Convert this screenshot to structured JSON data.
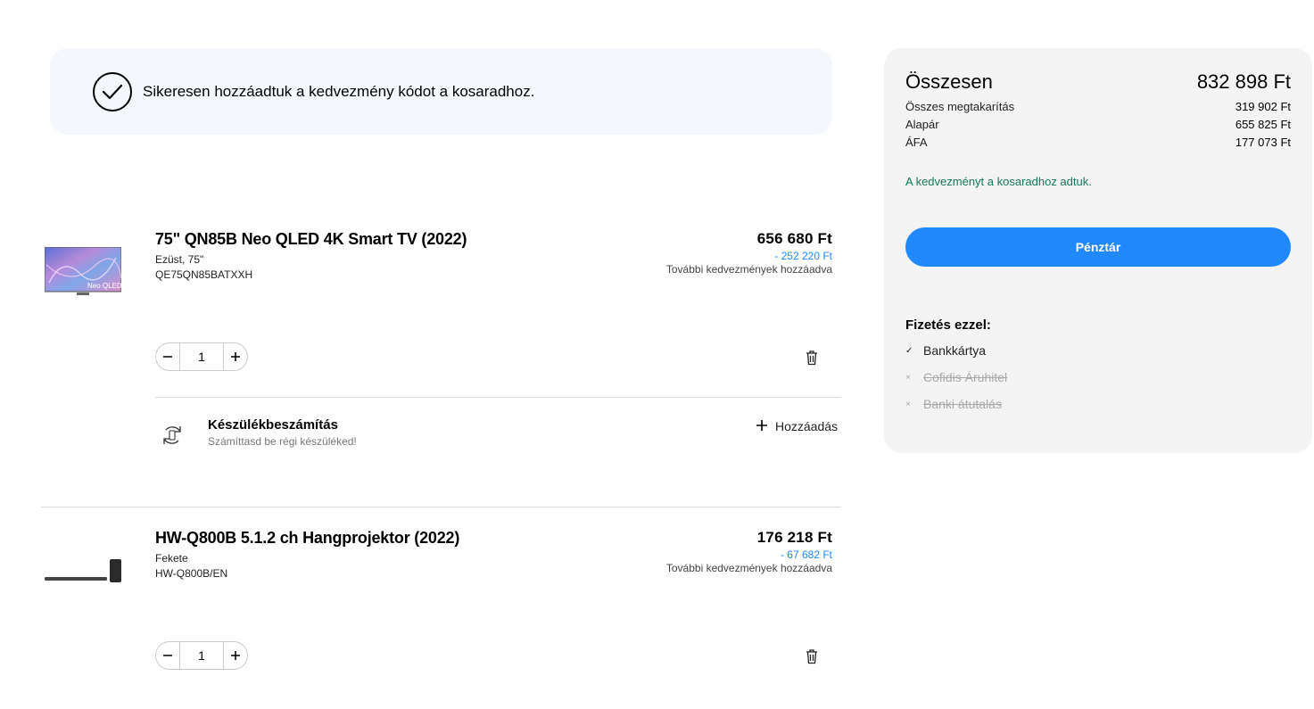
{
  "banner": {
    "message": "Sikeresen hozzáadtuk a kedvezmény kódot a kosaradhoz."
  },
  "cart": {
    "items": [
      {
        "title": "75\" QN85B Neo QLED 4K Smart TV (2022)",
        "variant": "Ezüst, 75\"",
        "sku": "QE75QN85BATXXH",
        "price": "656 680 Ft",
        "discount": "- 252 220 Ft",
        "extra_note": "További kedvezmények hozzáadva",
        "quantity": "1",
        "thumb_label": "Neo QLED"
      },
      {
        "title": "HW-Q800B 5.1.2 ch Hangprojektor (2022)",
        "variant": "Fekete",
        "sku": "HW-Q800B/EN",
        "price": "176 218 Ft",
        "discount": "- 67 682 Ft",
        "extra_note": "További kedvezmények hozzáadva",
        "quantity": "1"
      }
    ],
    "tradein": {
      "title": "Készülékbeszámítás",
      "subtitle": "Számíttasd be régi készüléked!",
      "add_label": "Hozzáadás"
    }
  },
  "summary": {
    "total_label": "Összesen",
    "total_value": "832 898 Ft",
    "rows": [
      {
        "label": "Összes megtakarítás",
        "value": "319 902 Ft"
      },
      {
        "label": "Alapár",
        "value": "655 825 Ft"
      },
      {
        "label": "ÁFA",
        "value": "177 073 Ft"
      }
    ],
    "discount_note": "A kedvezményt a kosaradhoz adtuk.",
    "checkout_label": "Pénztár",
    "payment_title": "Fizetés ezzel:",
    "payment_methods": [
      {
        "label": "Bankkártya",
        "available": true,
        "mark": "✓"
      },
      {
        "label": "Cofidis Áruhitel",
        "available": false,
        "mark": "×"
      },
      {
        "label": "Banki átutalás",
        "available": false,
        "mark": "×"
      }
    ]
  },
  "colors": {
    "accent": "#2189ff",
    "success_text": "#127a5b",
    "banner_bg": "#f4f7fc",
    "summary_bg": "#f4f4f4"
  }
}
